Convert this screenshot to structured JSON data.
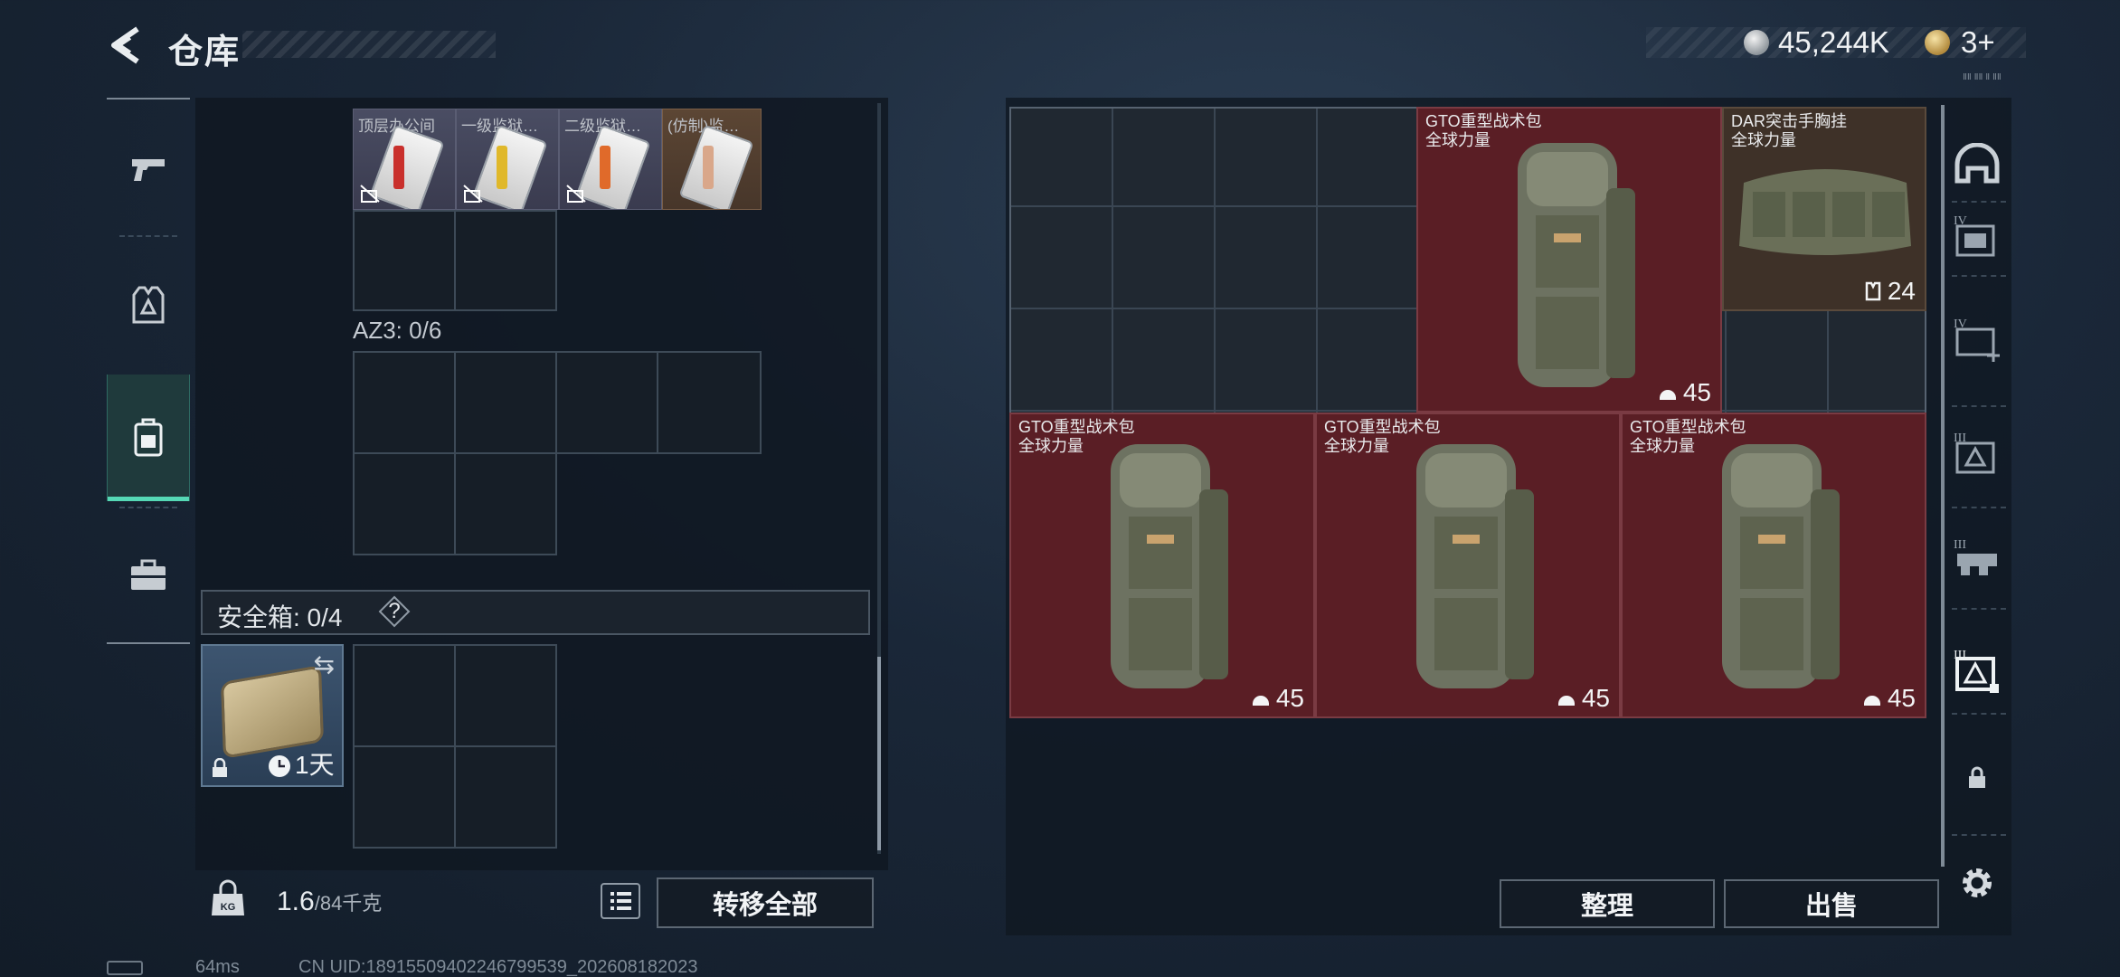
{
  "header": {
    "title": "仓库",
    "money": "45,244K",
    "tokens": "3+",
    "tiny_text": "ⅡⅡ ⅡⅡ Ⅱ ⅡⅡ"
  },
  "left_tabs": [
    {
      "id": "weapons",
      "icon": "pistol-icon",
      "active": false
    },
    {
      "id": "armor",
      "icon": "vest-icon",
      "active": false
    },
    {
      "id": "containers",
      "icon": "backpack-icon",
      "active": true
    },
    {
      "id": "cases",
      "icon": "briefcase-icon",
      "active": false
    }
  ],
  "keycards": [
    {
      "name": "顶层办公间",
      "stripe": "#c9302c",
      "tier": "gray"
    },
    {
      "name": "一级监狱…",
      "stripe": "#e0b82a",
      "tier": "gray"
    },
    {
      "name": "二级监狱…",
      "stripe": "#e06a2a",
      "tier": "gray"
    },
    {
      "name": "(仿制)监…",
      "stripe": "#d9a78a",
      "tier": "gold"
    }
  ],
  "az3": {
    "label": "AZ3: 0/6"
  },
  "safe": {
    "label": "安全箱: 0/4",
    "question": "?",
    "duration": "1天"
  },
  "weight": {
    "current": "1.6",
    "max": "/84千克"
  },
  "buttons": {
    "transfer_all": "转移全部",
    "tidy": "整理",
    "sell": "出售"
  },
  "storage_items": [
    {
      "name": "GTO重型战术包",
      "sub": "全球力量",
      "count": "45",
      "type": "gto"
    },
    {
      "name": "DAR突击手胸挂",
      "sub": "全球力量",
      "count": "24",
      "type": "dar"
    },
    {
      "name": "GTO重型战术包",
      "sub": "全球力量",
      "count": "45",
      "type": "gto"
    },
    {
      "name": "GTO重型战术包",
      "sub": "全球力量",
      "count": "45",
      "type": "gto"
    },
    {
      "name": "GTO重型战术包",
      "sub": "全球力量",
      "count": "45",
      "type": "gto"
    }
  ],
  "right_tabs": [
    {
      "icon": "helmet-icon",
      "label": ""
    },
    {
      "icon": "armor-tier4-icon",
      "label": "IV"
    },
    {
      "icon": "armor-tier4-plus-icon",
      "label": "IV"
    },
    {
      "icon": "armor-tier3-icon",
      "label": "III"
    },
    {
      "icon": "rig-tier3-icon",
      "label": "III"
    },
    {
      "icon": "backpack-tier3-icon",
      "label": "III"
    },
    {
      "icon": "lock-icon",
      "label": ""
    },
    {
      "icon": "gear-icon",
      "label": ""
    }
  ],
  "footer": {
    "ping": "64ms",
    "uid": "CN UID:189155094022467995​39_202608182023"
  },
  "colors": {
    "accent": "#55d8b5",
    "red_item_bg": "#5a1e25",
    "brown_item_bg": "#3e3128"
  }
}
